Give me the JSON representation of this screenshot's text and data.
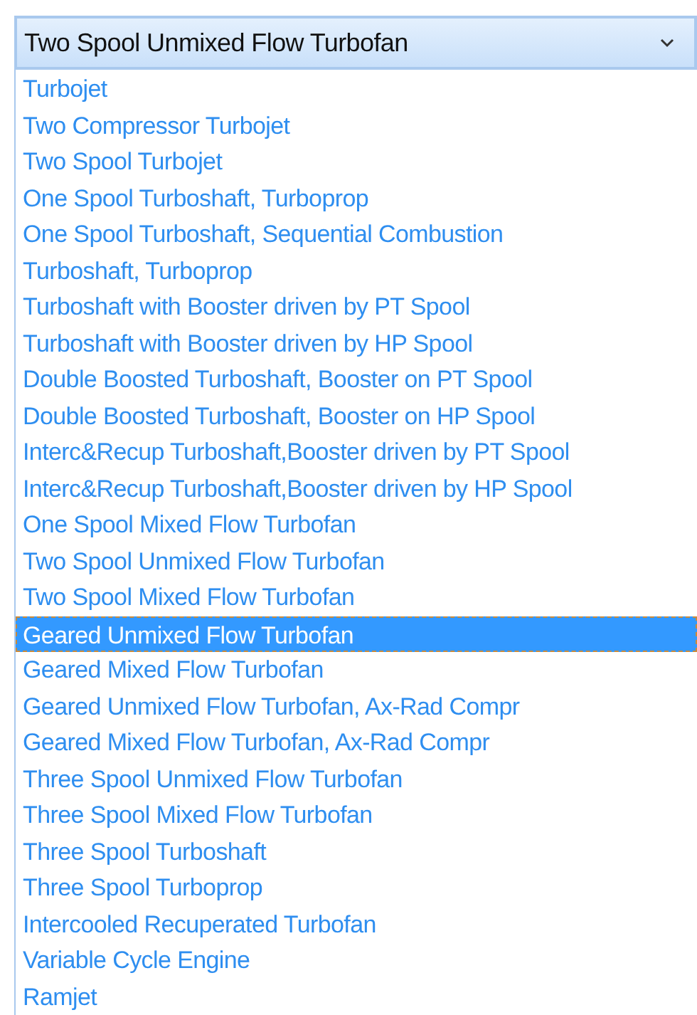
{
  "combobox": {
    "value": "Two Spool Unmixed Flow Turbofan"
  },
  "options": [
    {
      "label": "Turbojet",
      "selected": false
    },
    {
      "label": "Two Compressor Turbojet",
      "selected": false
    },
    {
      "label": "Two Spool Turbojet",
      "selected": false
    },
    {
      "label": "One Spool Turboshaft, Turboprop",
      "selected": false
    },
    {
      "label": "One Spool Turboshaft, Sequential Combustion",
      "selected": false
    },
    {
      "label": "Turboshaft, Turboprop",
      "selected": false
    },
    {
      "label": "Turboshaft with Booster driven by PT Spool",
      "selected": false
    },
    {
      "label": "Turboshaft with Booster driven by HP Spool",
      "selected": false
    },
    {
      "label": "Double Boosted Turboshaft, Booster on PT Spool",
      "selected": false
    },
    {
      "label": "Double Boosted Turboshaft, Booster on HP Spool",
      "selected": false
    },
    {
      "label": "Interc&Recup Turboshaft,Booster driven by PT Spool",
      "selected": false
    },
    {
      "label": "Interc&Recup Turboshaft,Booster driven by HP Spool",
      "selected": false
    },
    {
      "label": "One Spool Mixed Flow Turbofan",
      "selected": false
    },
    {
      "label": "Two Spool Unmixed Flow Turbofan",
      "selected": false
    },
    {
      "label": "Two Spool Mixed Flow Turbofan",
      "selected": false
    },
    {
      "label": "Geared Unmixed Flow Turbofan",
      "selected": true
    },
    {
      "label": "Geared Mixed Flow Turbofan",
      "selected": false
    },
    {
      "label": "Geared Unmixed Flow Turbofan, Ax-Rad Compr",
      "selected": false
    },
    {
      "label": "Geared Mixed Flow Turbofan, Ax-Rad Compr",
      "selected": false
    },
    {
      "label": "Three Spool Unmixed Flow Turbofan",
      "selected": false
    },
    {
      "label": "Three Spool Mixed Flow Turbofan",
      "selected": false
    },
    {
      "label": "Three Spool Turboshaft",
      "selected": false
    },
    {
      "label": "Three Spool Turboprop",
      "selected": false
    },
    {
      "label": "Intercooled Recuperated Turbofan",
      "selected": false
    },
    {
      "label": "Variable Cycle Engine",
      "selected": false
    },
    {
      "label": "Ramjet",
      "selected": false
    }
  ]
}
